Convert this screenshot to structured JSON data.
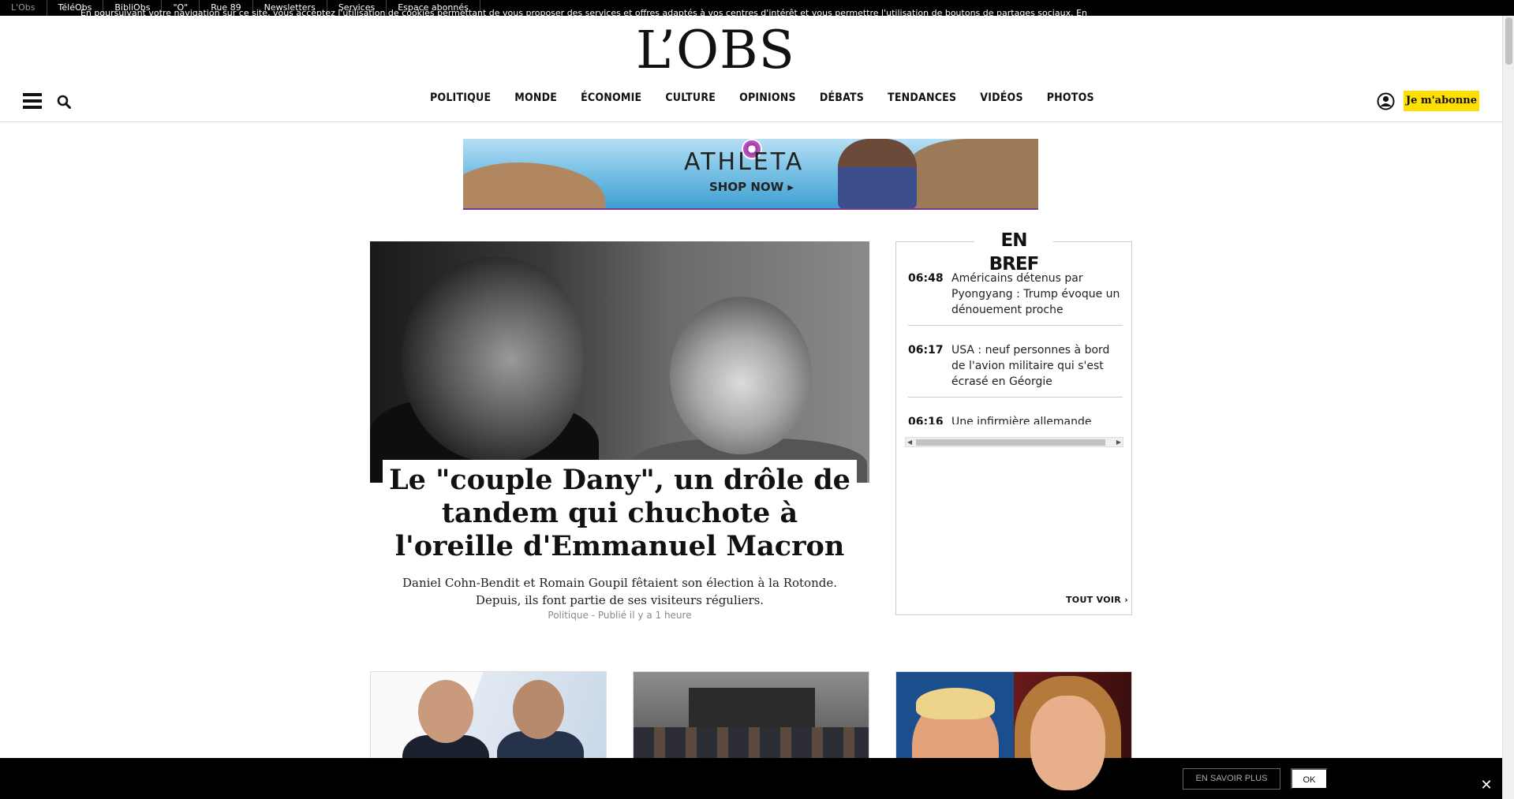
{
  "topbar": {
    "items": [
      "L'Obs",
      "TéléObs",
      "BibliObs",
      "\"O\"",
      "Rue 89",
      "Newsletters",
      "Services",
      "Espace abonnés"
    ]
  },
  "header": {
    "logo": "L’OBS",
    "nav": [
      "POLITIQUE",
      "MONDE",
      "ÉCONOMIE",
      "CULTURE",
      "OPINIONS",
      "DÉBATS",
      "TENDANCES",
      "VIDÉOS",
      "PHOTOS"
    ],
    "subscribe_label": "Je m'abonne",
    "icons": {
      "menu": "hamburger-icon",
      "search": "search-icon",
      "account": "user-icon"
    }
  },
  "ad": {
    "brand": "ATHLETA",
    "cta": "SHOP NOW ▸"
  },
  "main_article": {
    "title": "Le \"couple Dany\", un drôle de tandem qui chuchote à l'oreille d'Emmanuel Macron",
    "summary": "Daniel Cohn-Bendit et Romain Goupil fêtaient son élection à la Rotonde. Depuis, ils font partie de ses visiteurs réguliers.",
    "meta": "Politique - Publié il y a 1 heure"
  },
  "bref": {
    "title": "EN BREF",
    "items": [
      {
        "time": "06:48",
        "text": "Américains détenus par Pyongyang : Trump évoque un dénouement proche"
      },
      {
        "time": "06:17",
        "text": "USA : neuf personnes à bord de l'avion militaire qui s'est écrasé en Géorgie"
      },
      {
        "time": "06:16",
        "text": "Une infirmière allemande kidnappée en Somalie par des"
      }
    ],
    "more_label": "TOUT VOIR"
  },
  "cookie": {
    "text": "En poursuivant votre navigation sur ce site, vous acceptez l'utilisation de cookies permettant de vous proposer des services et offres adaptés à vos centres d'intérêt et vous permettre l'utilisation de boutons de partages sociaux.",
    "link": "En savoir plus et gérer ces paramètres",
    "more_label": "EN SAVOIR PLUS",
    "ok_label": "OK",
    "close": "✕"
  },
  "colors": {
    "subscribe_bg": "#ffdf00",
    "topbar_bg": "#000000"
  }
}
